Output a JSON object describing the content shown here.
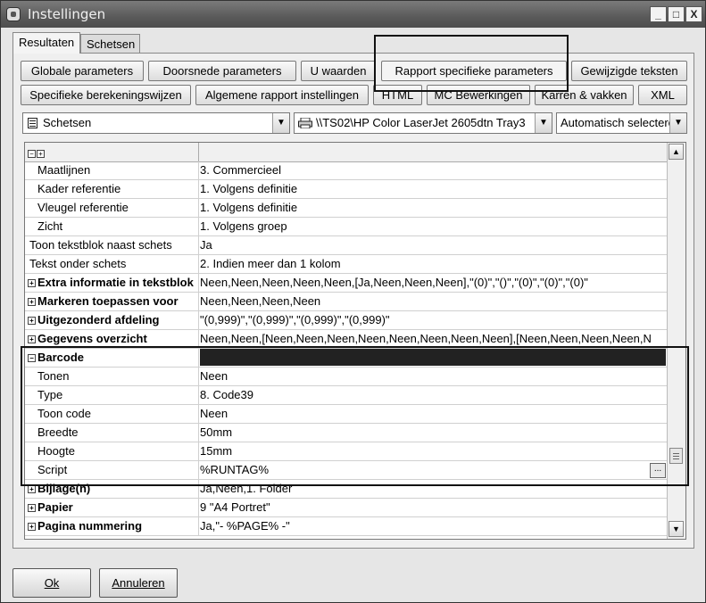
{
  "window": {
    "title": "Instellingen",
    "controls": {
      "minimize": "_",
      "maximize": "□",
      "close": "X"
    }
  },
  "tabs": [
    {
      "label": "Resultaten",
      "active": true
    },
    {
      "label": "Schetsen",
      "active": false
    }
  ],
  "buttons_row1": [
    "Globale parameters",
    "Doorsnede parameters",
    "U waarden",
    "Rapport specifieke parameters",
    "Gewijzigde teksten"
  ],
  "buttons_row2": [
    "Specifieke berekeningswijzen",
    "Algemene rapport instellingen",
    "HTML",
    "MC Bewerkingen",
    "Karren & vakken",
    "XML"
  ],
  "combos": {
    "section": "Schetsen",
    "printer": "\\\\TS02\\HP Color LaserJet 2605dtn Tray3",
    "mode": "Automatisch selecteren"
  },
  "grid": {
    "header_icons": [
      "minus",
      "plus"
    ],
    "rows": [
      {
        "key": "Maatlijnen",
        "value": "3. Commercieel"
      },
      {
        "key": "Kader referentie",
        "value": "1. Volgens definitie"
      },
      {
        "key": "Vleugel referentie",
        "value": "1. Volgens definitie"
      },
      {
        "key": "Zicht",
        "value": "1. Volgens groep"
      },
      {
        "key": "Toon tekstblok naast schets",
        "value": "Ja"
      },
      {
        "key": "Tekst onder schets",
        "value": "2. Indien meer dan 1 kolom"
      },
      {
        "key": "Extra informatie in tekstblok",
        "value": "Neen,Neen,Neen,Neen,Neen,[Ja,Neen,Neen,Neen],\"(0)\",\"()\",\"(0)\",\"(0)\",\"(0)\""
      },
      {
        "key": "Markeren toepassen voor",
        "value": "Neen,Neen,Neen,Neen"
      },
      {
        "key": "Uitgezonderd afdeling",
        "value": "\"(0,999)\",\"(0,999)\",\"(0,999)\",\"(0,999)\""
      },
      {
        "key": "Gegevens overzicht",
        "value": "Neen,Neen,[Neen,Neen,Neen,Neen,Neen,Neen,Neen,Neen],[Neen,Neen,Neen,Neen,N"
      },
      {
        "key": "Barcode",
        "value": ""
      },
      {
        "key": "Tonen",
        "value": "Neen"
      },
      {
        "key": "Type",
        "value": "8. Code39"
      },
      {
        "key": "Toon code",
        "value": "Neen"
      },
      {
        "key": "Breedte",
        "value": "50mm"
      },
      {
        "key": "Hoogte",
        "value": "15mm"
      },
      {
        "key": "Script",
        "value": "%RUNTAG%"
      },
      {
        "key": "Bijlage(n)",
        "value": "Ja,Neen,1. Folder"
      },
      {
        "key": "Papier",
        "value": "9 \"A4 Portret\""
      },
      {
        "key": "Pagina nummering",
        "value": "Ja,\"- %PAGE% -\""
      }
    ],
    "ellipsis_label": "..."
  },
  "footer": {
    "ok": "Ok",
    "cancel": "Annuleren"
  }
}
